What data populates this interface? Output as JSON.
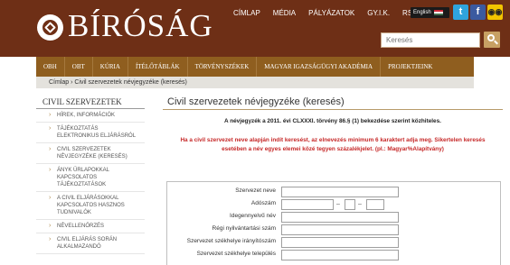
{
  "header": {
    "logo_text": "BÍRÓSÁG",
    "topnav": [
      "CÍMLAP",
      "MÉDIA",
      "PÁLYÁZATOK",
      "GY.I.K.",
      "RSS"
    ],
    "lang_label": "English",
    "search_placeholder": "Keresés",
    "social_twitter": "t",
    "social_facebook": "f",
    "social_accessibility": "◉◉"
  },
  "mainnav": [
    "OBH",
    "OBT",
    "KÚRIA",
    "ÍTÉLŐTÁBLÁK",
    "TÖRVÉNYSZÉKEK",
    "MAGYAR IGAZSÁGÜGYI AKADÉMIA",
    "PROJEKTJEINK"
  ],
  "breadcrumb": "Címlap › Civil szervezetek névjegyzéke (keresés)",
  "sidebar": {
    "title": "CIVIL SZERVEZETEK",
    "items": [
      "HÍREK, INFORMÁCIÓK",
      "TÁJÉKOZTATÁS ELEKTRONIKUS ELJÁRÁSRÓL",
      "CIVIL SZERVEZETEK NÉVJEGYZÉKE (KERESÉS)",
      "ÁNYK ŰRLAPOKKAL KAPCSOLATOS TÁJÉKOZTATÁSOK",
      "A CIVIL ELJÁRÁSOKKAL KAPCSOLATOS HASZNOS TUDNIVALÓK",
      "NÉVELLENŐRZÉS",
      "CIVIL ELJÁRÁS SORÁN ALKALMAZANDÓ"
    ]
  },
  "content": {
    "title": "Civil szervezetek névjegyzéke (keresés)",
    "note1": "A névjegyzék a 2011. évi CLXXXI. törvény 86.§ (1) bekezdése szerint közhiteles.",
    "note2": "Ha a civil szervezet neve alapján indít keresést, az elnevezés minimum 6 karaktert adja meg. Sikertelen keresés esetében a név egyes elemei közé tegyen százalékjelet. (pl.: Magyar%Alapítvány)",
    "form": {
      "fields": [
        "Szervezet neve",
        "Adószám",
        "Idegennyelvű név",
        "Régi nyilvántartási szám",
        "Szervezet székhelye irányítószám",
        "Szervezet székhelye település"
      ],
      "dash": "–"
    }
  },
  "colors": {
    "header_bg": "#6e2f16",
    "nav_bg": "#8f5e1f",
    "alert_red": "#c62828",
    "accent_gold": "#c7a063"
  }
}
